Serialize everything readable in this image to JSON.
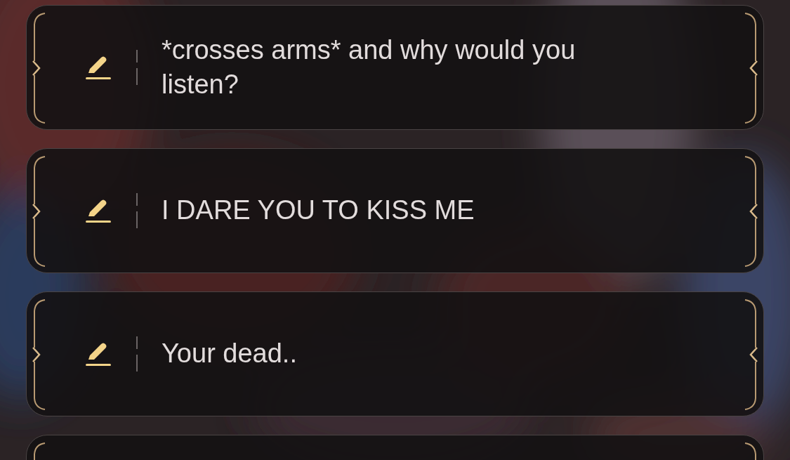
{
  "options": [
    {
      "text": "*crosses arms* and why would you listen?"
    },
    {
      "text": "I DARE YOU TO KISS ME"
    },
    {
      "text": "Your dead.."
    }
  ],
  "partial_card": true
}
